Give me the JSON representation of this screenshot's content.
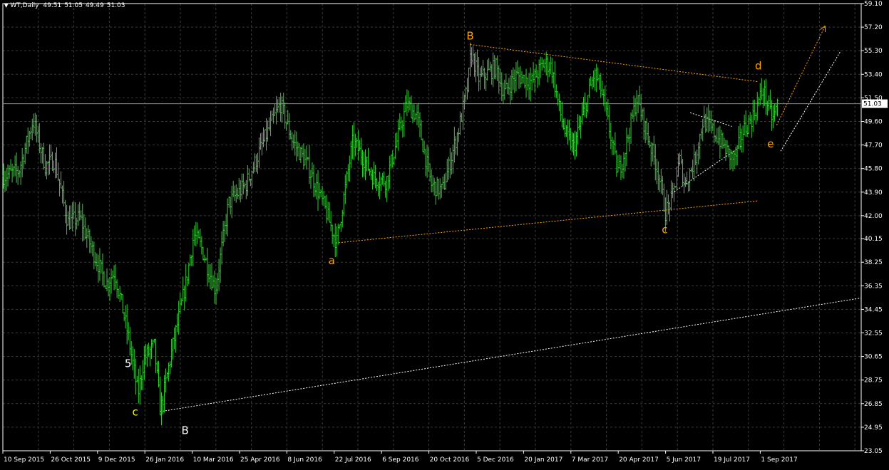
{
  "header": {
    "symbol": "WT,Daily",
    "open": "49.51",
    "high": "51.05",
    "low": "49.49",
    "close": "51.03"
  },
  "chart_data": {
    "type": "bar",
    "title": "",
    "xlabel": "",
    "ylabel": "",
    "ylim": [
      23.05,
      59.1
    ],
    "grid": true,
    "current_price": 51.03,
    "y_ticks": [
      "59.10",
      "57.20",
      "55.30",
      "53.40",
      "51.50",
      "49.60",
      "47.70",
      "45.80",
      "43.90",
      "42.00",
      "40.15",
      "38.25",
      "36.35",
      "34.45",
      "32.55",
      "30.65",
      "28.75",
      "26.85",
      "24.95",
      "23.05"
    ],
    "x_ticks": [
      "10 Sep 2015",
      "26 Oct 2015",
      "9 Dec 2015",
      "26 Jan 2016",
      "10 Mar 2016",
      "25 Apr 2016",
      "8 Jun 2016",
      "22 Jul 2016",
      "6 Sep 2016",
      "20 Oct 2016",
      "5 Dec 2016",
      "20 Jan 2017",
      "7 Mar 2017",
      "20 Apr 2017",
      "5 Jun 2017",
      "19 Jul 2017",
      "1 Sep 2017"
    ],
    "price_path": [
      {
        "date": "2015-09-10",
        "price": 45.2
      },
      {
        "date": "2015-09-25",
        "price": 45.6
      },
      {
        "date": "2015-10-09",
        "price": 49.7
      },
      {
        "date": "2015-10-21",
        "price": 46.0
      },
      {
        "date": "2015-10-30",
        "price": 46.5
      },
      {
        "date": "2015-11-12",
        "price": 41.5
      },
      {
        "date": "2015-11-24",
        "price": 41.8
      },
      {
        "date": "2015-12-05",
        "price": 39.5
      },
      {
        "date": "2015-12-20",
        "price": 36.5
      },
      {
        "date": "2015-12-28",
        "price": 37.5
      },
      {
        "date": "2016-01-10",
        "price": 32.5
      },
      {
        "date": "2016-01-20",
        "price": 27.6
      },
      {
        "date": "2016-01-26",
        "price": 30.5
      },
      {
        "date": "2016-02-05",
        "price": 31.5
      },
      {
        "date": "2016-02-11",
        "price": 26.2
      },
      {
        "date": "2016-02-22",
        "price": 31.0
      },
      {
        "date": "2016-03-07",
        "price": 36.5
      },
      {
        "date": "2016-03-15",
        "price": 40.5
      },
      {
        "date": "2016-03-22",
        "price": 39.5
      },
      {
        "date": "2016-04-05",
        "price": 36.0
      },
      {
        "date": "2016-04-18",
        "price": 43.0
      },
      {
        "date": "2016-05-05",
        "price": 44.5
      },
      {
        "date": "2016-05-25",
        "price": 48.5
      },
      {
        "date": "2016-06-08",
        "price": 51.0
      },
      {
        "date": "2016-06-20",
        "price": 48.0
      },
      {
        "date": "2016-07-05",
        "price": 46.0
      },
      {
        "date": "2016-07-22",
        "price": 42.5
      },
      {
        "date": "2016-08-02",
        "price": 39.8
      },
      {
        "date": "2016-08-18",
        "price": 48.0
      },
      {
        "date": "2016-08-26",
        "price": 47.0
      },
      {
        "date": "2016-09-08",
        "price": 45.0
      },
      {
        "date": "2016-09-20",
        "price": 44.8
      },
      {
        "date": "2016-10-10",
        "price": 51.0
      },
      {
        "date": "2016-10-20",
        "price": 50.0
      },
      {
        "date": "2016-11-03",
        "price": 44.5
      },
      {
        "date": "2016-11-14",
        "price": 44.0
      },
      {
        "date": "2016-11-30",
        "price": 49.0
      },
      {
        "date": "2016-12-09",
        "price": 52.5
      },
      {
        "date": "2016-12-12",
        "price": 55.2
      },
      {
        "date": "2016-12-20",
        "price": 53.0
      },
      {
        "date": "2017-01-06",
        "price": 54.0
      },
      {
        "date": "2017-01-13",
        "price": 51.8
      },
      {
        "date": "2017-01-25",
        "price": 53.3
      },
      {
        "date": "2017-02-10",
        "price": 52.8
      },
      {
        "date": "2017-02-22",
        "price": 54.3
      },
      {
        "date": "2017-03-01",
        "price": 54.0
      },
      {
        "date": "2017-03-09",
        "price": 50.5
      },
      {
        "date": "2017-03-15",
        "price": 48.5
      },
      {
        "date": "2017-03-23",
        "price": 47.5
      },
      {
        "date": "2017-04-04",
        "price": 51.0
      },
      {
        "date": "2017-04-12",
        "price": 53.4
      },
      {
        "date": "2017-04-18",
        "price": 52.5
      },
      {
        "date": "2017-04-27",
        "price": 49.0
      },
      {
        "date": "2017-05-05",
        "price": 45.5
      },
      {
        "date": "2017-05-10",
        "price": 46.5
      },
      {
        "date": "2017-05-24",
        "price": 51.5
      },
      {
        "date": "2017-06-05",
        "price": 48.0
      },
      {
        "date": "2017-06-14",
        "price": 45.5
      },
      {
        "date": "2017-06-21",
        "price": 42.3
      },
      {
        "date": "2017-06-28",
        "price": 43.5
      },
      {
        "date": "2017-07-05",
        "price": 46.5
      },
      {
        "date": "2017-07-10",
        "price": 44.5
      },
      {
        "date": "2017-07-20",
        "price": 46.5
      },
      {
        "date": "2017-07-28",
        "price": 49.7
      },
      {
        "date": "2017-08-10",
        "price": 48.5
      },
      {
        "date": "2017-08-22",
        "price": 47.0
      },
      {
        "date": "2017-08-28",
        "price": 46.5
      },
      {
        "date": "2017-09-05",
        "price": 48.8
      },
      {
        "date": "2017-09-15",
        "price": 50.0
      },
      {
        "date": "2017-09-25",
        "price": 52.2
      },
      {
        "date": "2017-10-02",
        "price": 50.2
      },
      {
        "date": "2017-10-05",
        "price": 49.8
      },
      {
        "date": "2017-10-09",
        "price": 51.03
      }
    ],
    "wave_labels": [
      {
        "text": "5",
        "date": "2016-01-11",
        "price": 29.8,
        "color": "#ffffff"
      },
      {
        "text": "c",
        "date": "2016-01-18",
        "price": 25.9,
        "color": "#ffff00"
      },
      {
        "text": "B",
        "date": "2016-03-07",
        "price": 24.4,
        "color": "#ffffff"
      },
      {
        "text": "a",
        "date": "2016-07-29",
        "price": 38.1,
        "color": "#ffa500"
      },
      {
        "text": "B",
        "date": "2016-12-12",
        "price": 56.2,
        "color": "#ffa500"
      },
      {
        "text": "c",
        "date": "2017-06-21",
        "price": 40.6,
        "color": "#ffa500"
      },
      {
        "text": "d",
        "date": "2017-09-21",
        "price": 53.8,
        "color": "#ffa500"
      },
      {
        "text": "e",
        "date": "2017-10-03",
        "price": 47.5,
        "color": "#ffa500"
      }
    ],
    "trendlines": [
      {
        "from": {
          "date": "2016-02-11",
          "price": 26.2
        },
        "to": {
          "date": "2017-10-23",
          "price": 34.45
        },
        "color": "#ffffff",
        "style": "dashed",
        "extend": true
      },
      {
        "from": {
          "date": "2017-10-13",
          "price": 47.2
        },
        "to": {
          "date": "2017-12-11",
          "price": 55.3
        },
        "color": "#ffffff",
        "style": "dashed"
      },
      {
        "from": {
          "date": "2016-08-02",
          "price": 39.8
        },
        "to": {
          "date": "2017-09-21",
          "price": 43.2
        },
        "color": "#ffa500",
        "style": "dashed"
      },
      {
        "from": {
          "date": "2016-12-12",
          "price": 55.8
        },
        "to": {
          "date": "2017-09-21",
          "price": 52.8
        },
        "color": "#ffa500",
        "style": "dashed"
      },
      {
        "from": {
          "date": "2017-06-28",
          "price": 43.8
        },
        "to": {
          "date": "2017-09-04",
          "price": 47.6
        },
        "color": "#ffffff",
        "style": "dashed"
      },
      {
        "from": {
          "date": "2017-07-16",
          "price": 50.3
        },
        "to": {
          "date": "2017-08-26",
          "price": 49.2
        },
        "color": "#ffffff",
        "style": "dashed"
      },
      {
        "from": {
          "date": "2017-10-09",
          "price": 49.3
        },
        "to": {
          "date": "2017-11-25",
          "price": 57.2
        },
        "color": "#ffa500",
        "style": "dashed",
        "arrow": true
      }
    ]
  },
  "colors": {
    "background": "#000000",
    "grid": "#3a3a3a",
    "bars": "#33cc33",
    "axis_text": "#ffffff",
    "current_price_line": "#8c8c8c",
    "current_price_tag_bg": "#ffffff",
    "current_price_tag_text": "#000000"
  }
}
